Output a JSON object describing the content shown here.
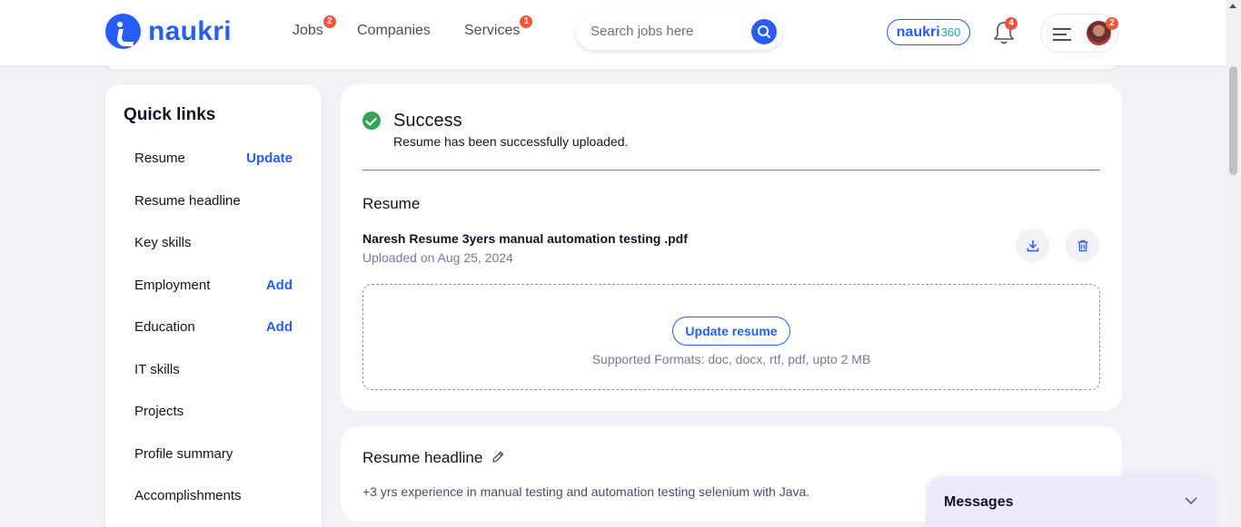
{
  "header": {
    "logo_text": "naukri",
    "nav": [
      {
        "label": "Jobs",
        "badge": "2"
      },
      {
        "label": "Companies",
        "badge": ""
      },
      {
        "label": "Services",
        "badge": "1"
      }
    ],
    "search_placeholder": "Search jobs here",
    "n360_label": "naukri",
    "n360_num": "360",
    "bell_badge": "4",
    "menu_badge": "2"
  },
  "sidebar": {
    "title": "Quick links",
    "items": [
      {
        "label": "Resume",
        "action": "Update"
      },
      {
        "label": "Resume headline",
        "action": ""
      },
      {
        "label": "Key skills",
        "action": ""
      },
      {
        "label": "Employment",
        "action": "Add"
      },
      {
        "label": "Education",
        "action": "Add"
      },
      {
        "label": "IT skills",
        "action": ""
      },
      {
        "label": "Projects",
        "action": ""
      },
      {
        "label": "Profile summary",
        "action": ""
      },
      {
        "label": "Accomplishments",
        "action": ""
      }
    ]
  },
  "resume_card": {
    "success_title": "Success",
    "success_message": "Resume has been successfully uploaded.",
    "section_title": "Resume",
    "file_name": "Naresh Resume 3yers manual automation testing .pdf",
    "uploaded": "Uploaded on Aug 25, 2024",
    "update_button": "Update resume",
    "formats": "Supported Formats: doc, docx, rtf, pdf, upto 2 MB"
  },
  "headline_card": {
    "title": "Resume headline",
    "text": "+3 yrs experience in manual testing and automation testing selenium with Java."
  },
  "messages": {
    "label": "Messages"
  },
  "colors": {
    "brand": "#275df5",
    "success": "#35a35a",
    "badge": "#f05537"
  }
}
